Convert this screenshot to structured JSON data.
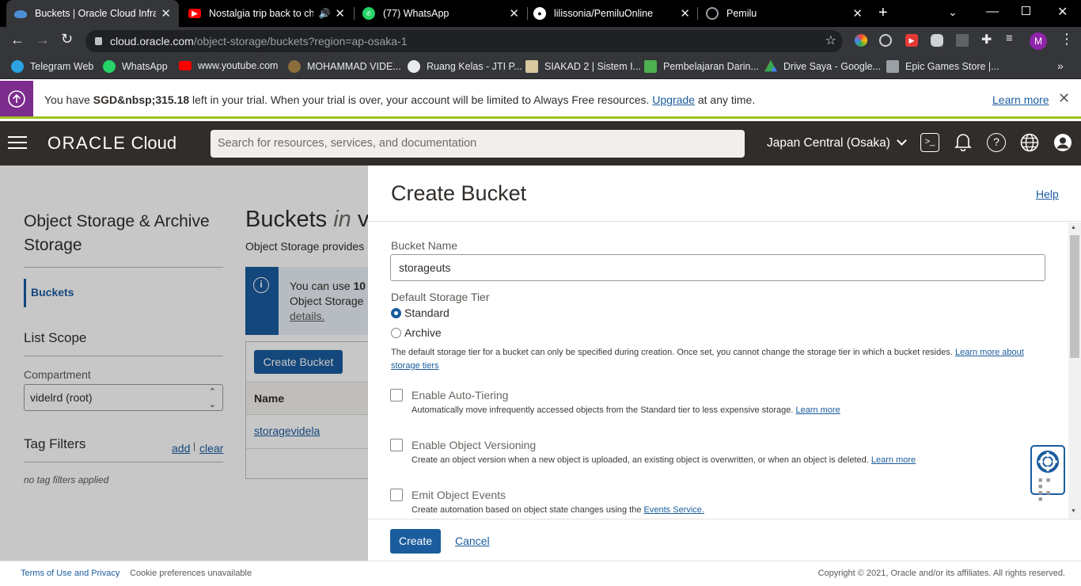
{
  "browser": {
    "tabs": [
      {
        "title": "Buckets | Oracle Cloud Infrastructure",
        "icon": "oracle-cloud-icon",
        "color": "#4d8fd6",
        "active": true
      },
      {
        "title": "Nostalgia trip back to ch",
        "icon": "youtube-icon",
        "color": "#ff0000",
        "audio": true
      },
      {
        "title": "(77) WhatsApp",
        "icon": "whatsapp-icon",
        "color": "#25d366"
      },
      {
        "title": "lilissonia/PemiluOnline",
        "icon": "github-icon",
        "color": "#ffffff"
      },
      {
        "title": "Pemilu",
        "icon": "globe-icon",
        "color": "#9aa0a6"
      }
    ],
    "url_host": "cloud.oracle.com",
    "url_path": "/object-storage/buckets?region=ap-osaka-1",
    "profile_initial": "M",
    "bookmarks": [
      {
        "label": "Telegram Web",
        "color": "#2aa3e0"
      },
      {
        "label": "WhatsApp",
        "color": "#25d366"
      },
      {
        "label": "www.youtube.com",
        "color": "#ff0000"
      },
      {
        "label": "MOHAMMAD VIDE...",
        "color": "#8a6d3b"
      },
      {
        "label": "Ruang Kelas - JTI P...",
        "color": "#e8eaed"
      },
      {
        "label": "SIAKAD 2 | Sistem I...",
        "color": "#d7c8a0"
      },
      {
        "label": "Pembelajaran Darin...",
        "color": "#4caf50"
      },
      {
        "label": "Drive Saya - Google...",
        "color": "#fbbc04"
      },
      {
        "label": "Epic Games Store |...",
        "color": "#9aa0a6"
      }
    ]
  },
  "trial": {
    "text_before": "You have",
    "amount": "SGD&nbsp;315.18",
    "text_after": "left in your trial. When your trial is over, your account will be limited to Always Free resources.",
    "upgrade": "Upgrade",
    "text_end": "at any time.",
    "learn_more": "Learn more"
  },
  "header": {
    "logo_oracle": "ORACLE",
    "logo_cloud": "Cloud",
    "search_placeholder": "Search for resources, services, and documentation",
    "region": "Japan Central (Osaka)"
  },
  "left": {
    "section_title": "Object Storage & Archive Storage",
    "nav_buckets": "Buckets",
    "list_scope": "List Scope",
    "compartment_label": "Compartment",
    "compartment_value": "videlrd (root)",
    "tag_filters": "Tag Filters",
    "add": "add",
    "clear": "clear",
    "no_tags": "no tag filters applied"
  },
  "main": {
    "title_start": "Buckets",
    "title_in": "in",
    "title_rest": "vi",
    "desc": "Object Storage provides",
    "info_line1_a": "You can use",
    "info_line1_b": "10",
    "info_line2": "Object Storage",
    "info_line3": "details.",
    "create_bucket": "Create Bucket",
    "col_name": "Name",
    "row1": "storagevidela"
  },
  "panel": {
    "title": "Create Bucket",
    "help": "Help",
    "bucket_name_label": "Bucket Name",
    "bucket_name_value": "storageuts",
    "tier_label": "Default Storage Tier",
    "tier_standard": "Standard",
    "tier_archive": "Archive",
    "tier_desc": "The default storage tier for a bucket can only be specified during creation. Once set, you cannot change the storage tier in which a bucket resides.",
    "tier_link1": "Learn more about",
    "tier_link2": "storage tiers",
    "auto_tiering": "Enable Auto-Tiering",
    "auto_tiering_desc": "Automatically move infrequently accessed objects from the Standard tier to less expensive storage.",
    "learn_more": "Learn more",
    "versioning": "Enable Object Versioning",
    "versioning_desc": "Create an object version when a new object is uploaded, an existing object is overwritten, or when an object is deleted.",
    "events": "Emit Object Events",
    "events_desc": "Create automation based on object state changes using the",
    "events_link": "Events Service.",
    "create": "Create",
    "cancel": "Cancel"
  },
  "footer": {
    "terms": "Terms of Use and Privacy",
    "cookies": "Cookie preferences unavailable",
    "copyright": "Copyright © 2021, Oracle and/or its affiliates. All rights reserved."
  }
}
